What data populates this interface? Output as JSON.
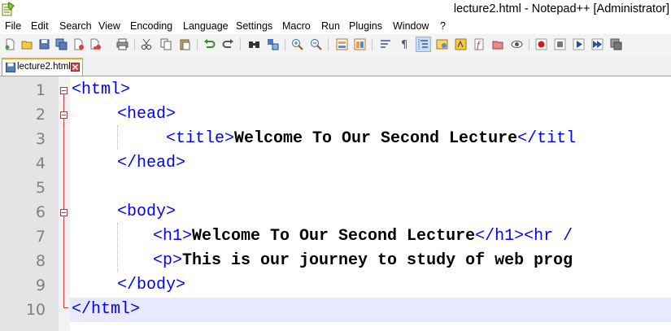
{
  "window": {
    "title": "lecture2.html - Notepad++ [Administrator]"
  },
  "menu": {
    "items": [
      "File",
      "Edit",
      "Search",
      "View",
      "Encoding",
      "Language",
      "Settings",
      "Macro",
      "Run",
      "Plugins",
      "Window",
      "?"
    ]
  },
  "tabs": [
    {
      "label": "lecture2.html",
      "active": true
    }
  ],
  "editor": {
    "line_numbers": [
      "1",
      "2",
      "3",
      "4",
      "5",
      "6",
      "7",
      "8",
      "9",
      "10"
    ],
    "lines": [
      {
        "tag1": "<html>"
      },
      {
        "tag1": "<head>"
      },
      {
        "tag1": "<title>",
        "text1": "Welcome To Our Second Lecture",
        "tag2": "</titl"
      },
      {
        "tag1": "</head>"
      },
      {},
      {
        "tag1": "<body>"
      },
      {
        "tag1": "<h1>",
        "text1": "Welcome To Our Second Lecture",
        "tag2": "</h1><hr /"
      },
      {
        "tag1": "<p>",
        "text1": "This is our journey to study of web prog"
      },
      {
        "tag1": "</body>"
      },
      {
        "tag1": "</html>"
      }
    ],
    "current_line": 10
  },
  "colors": {
    "tag": "#0000ff",
    "text": "#000000",
    "line_number": "#808080",
    "current_line_bg": "#e8e8ff",
    "fold_marker": "#c04040",
    "active_tab_accent": "#f5a623"
  },
  "toolbar_icons": [
    "new-file-icon",
    "open-file-icon",
    "save-icon",
    "save-all-icon",
    "close-icon",
    "close-all-icon",
    "print-icon",
    "cut-icon",
    "copy-icon",
    "paste-icon",
    "undo-icon",
    "redo-icon",
    "find-icon",
    "replace-icon",
    "zoom-in-icon",
    "zoom-out-icon",
    "sync-vertical-icon",
    "sync-horizontal-icon",
    "word-wrap-icon",
    "show-all-characters-icon",
    "indent-guide-icon",
    "language-icon",
    "function-list-icon",
    "folder-workspace-icon",
    "document-map-icon",
    "monitor-icon",
    "record-macro-icon",
    "stop-macro-icon",
    "play-macro-icon",
    "run-macro-multiple-icon",
    "save-macro-icon"
  ]
}
